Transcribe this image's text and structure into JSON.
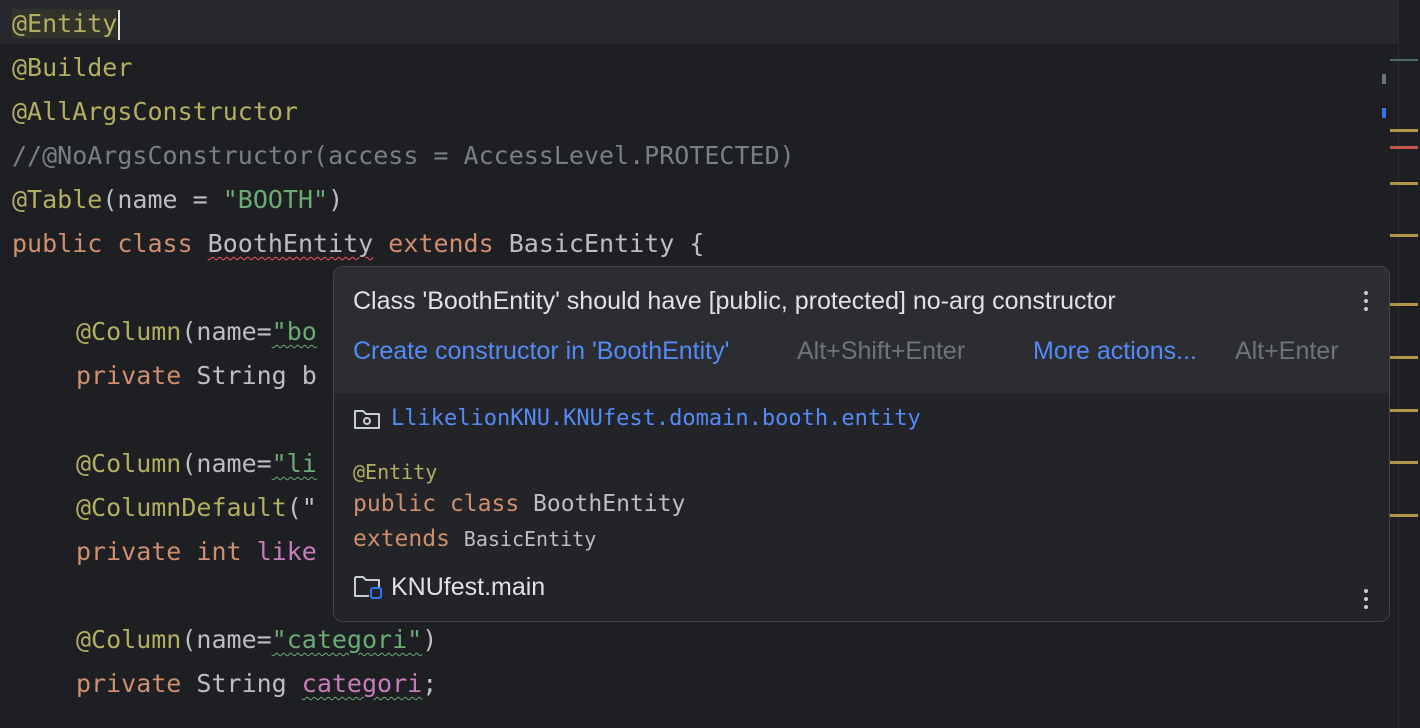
{
  "editor": {
    "lines": {
      "l1_ann": "@Entity",
      "l2_ann": "@Builder",
      "l3_ann": "@AllArgsConstructor",
      "l4_comment": "//@NoArgsConstructor(access = AccessLevel.PROTECTED)",
      "l5_ann": "@Table",
      "l5_open": "(name = ",
      "l5_str": "\"BOOTH\"",
      "l5_close": ")",
      "l6_kw1": "public class ",
      "l6_name": "BoothEntity",
      "l6_kw2": " extends ",
      "l6_rest": "BasicEntity {",
      "l8_ann": "@Column",
      "l8_open": "(name=",
      "l8_str": "\"bo",
      "l9_kw": "private ",
      "l9_type": "String b",
      "l11_ann": "@Column",
      "l11_open": "(name=",
      "l11_str": "\"li",
      "l12_ann": "@ColumnDefault",
      "l12_open": "(\"",
      "l13_kw": "private int ",
      "l13_fld": "like",
      "l15_ann": "@Column",
      "l15_open": "(name=",
      "l15_str": "\"categori\"",
      "l15_close": ")",
      "l16_kw": "private ",
      "l16_type": "String ",
      "l16_fld": "categori",
      "l16_end": ";"
    }
  },
  "popup": {
    "message": "Class 'BoothEntity' should have [public, protected] no-arg constructor",
    "action_label": "Create constructor in 'BoothEntity'",
    "action_shortcut": "Alt+Shift+Enter",
    "more_label": "More actions...",
    "more_shortcut": "Alt+Enter",
    "package": "LlikelionKNU.KNUfest.domain.booth.entity",
    "doc_annotation": "@Entity",
    "doc_kw": "public class ",
    "doc_class": "BoothEntity",
    "doc_extends_kw": "extends ",
    "doc_superclass": "BasicEntity",
    "module": "KNUfest.main",
    "package_icon": "package-folder-icon",
    "module_icon": "module-folder-icon"
  },
  "colors": {
    "background": "#1e1f22",
    "annotation": "#b3ae60",
    "keyword": "#cf8e6d",
    "string": "#6aab73",
    "comment": "#7a7e85",
    "field": "#c77dbb",
    "link": "#548af7",
    "error": "#f75464"
  }
}
